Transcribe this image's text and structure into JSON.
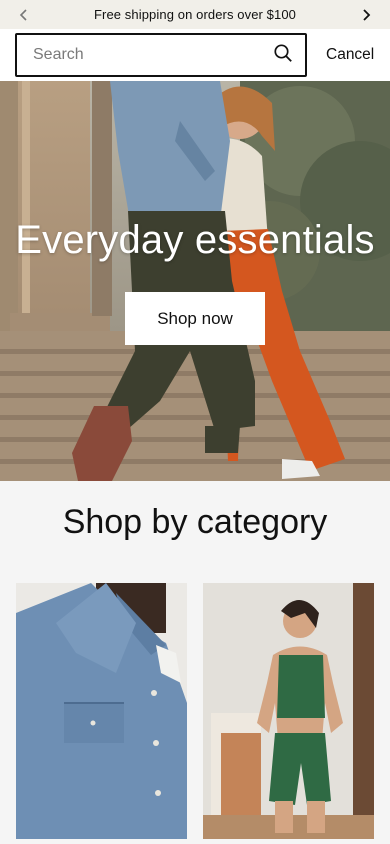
{
  "announcement": {
    "text": "Free shipping on orders over $100",
    "prev_icon": "chevron-left-icon",
    "next_icon": "chevron-right-icon"
  },
  "search": {
    "placeholder": "Search",
    "value": "",
    "icon": "search-icon",
    "cancel_label": "Cancel"
  },
  "hero": {
    "title": "Everyday essentials",
    "cta_label": "Shop now"
  },
  "categories": {
    "title": "Shop by category",
    "cards": [
      {
        "image": "denim-shirt-photo"
      },
      {
        "image": "green-activewear-photo"
      }
    ]
  },
  "colors": {
    "announcement_bg": "#f1efe9",
    "page_bg": "#f5f5f5",
    "text": "#111111",
    "pants_orange": "#d4571f",
    "pants_olive": "#3d3f2f"
  }
}
